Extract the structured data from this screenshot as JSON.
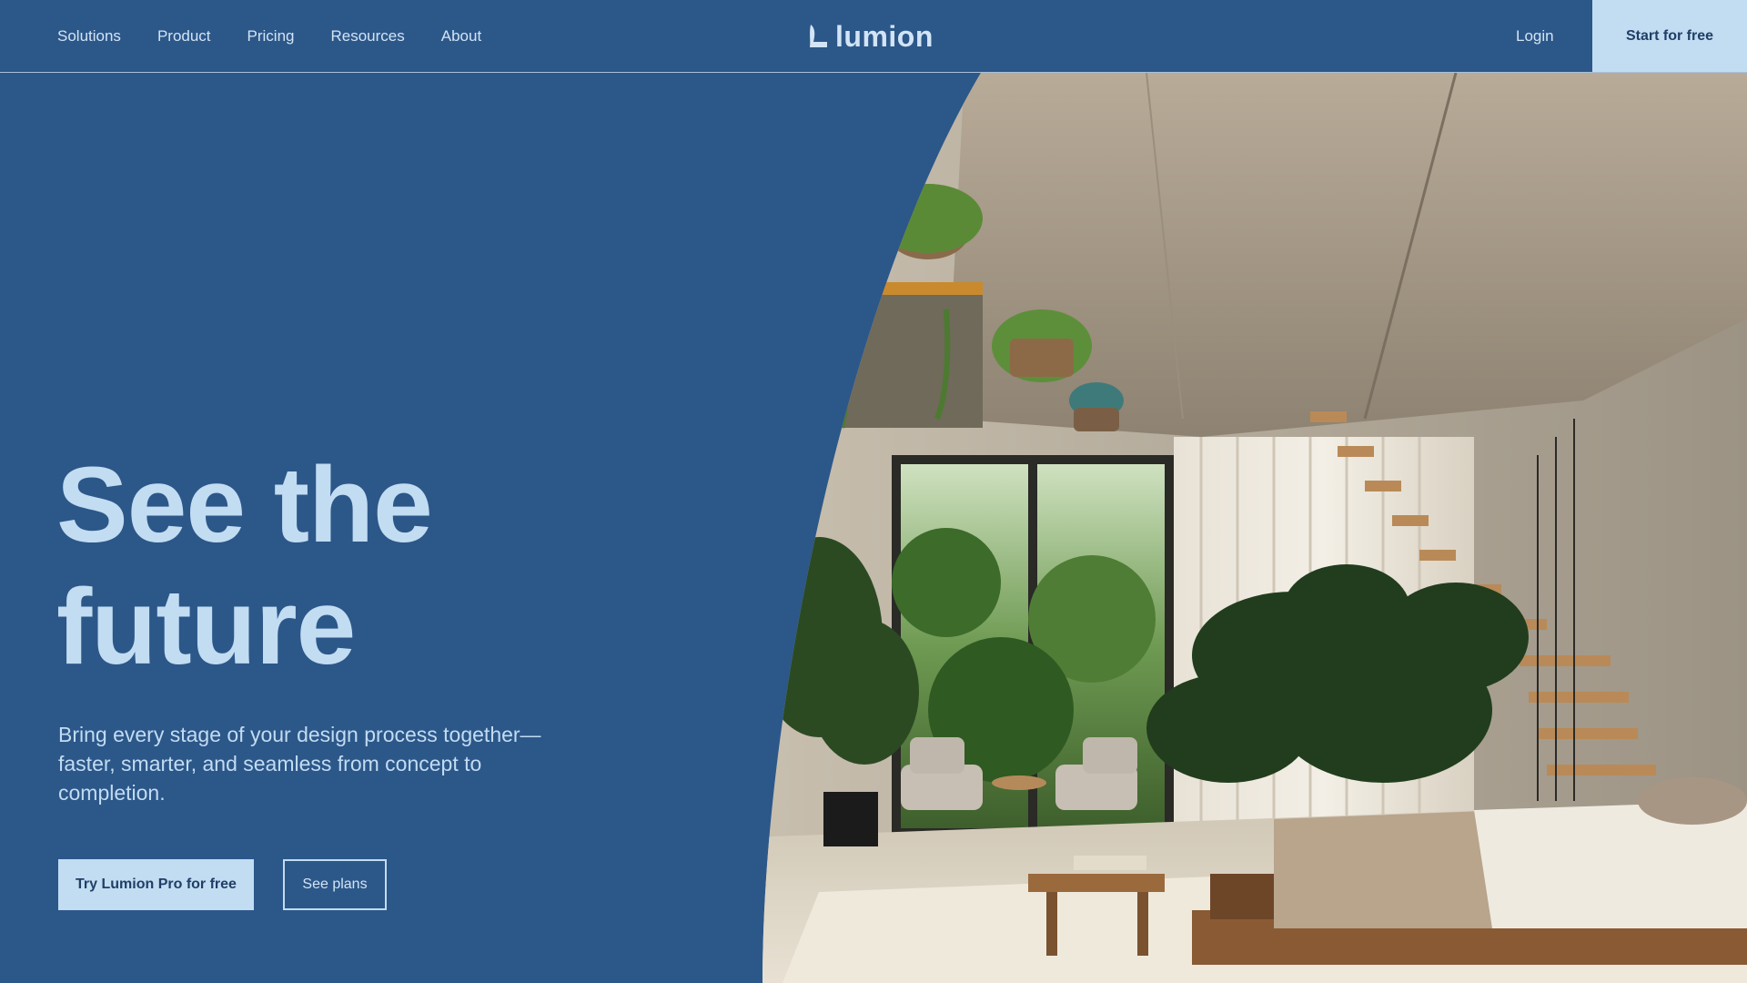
{
  "nav": {
    "links": [
      "Solutions",
      "Product",
      "Pricing",
      "Resources",
      "About"
    ],
    "logo_text": "lumion",
    "login_label": "Login",
    "start_label": "Start for free"
  },
  "hero": {
    "title_line1": "See the",
    "title_line2": "future",
    "subtitle": "Bring every stage of your design process together—faster, smarter, and seamless from concept to completion.",
    "primary_cta": "Try Lumion Pro for free",
    "secondary_cta": "See plans"
  },
  "colors": {
    "background": "#2c5789",
    "accent_light": "#c2dcf2",
    "text_dark": "#1f3f66"
  },
  "icons": {
    "logo": "lumion-leaf-logo-icon"
  }
}
